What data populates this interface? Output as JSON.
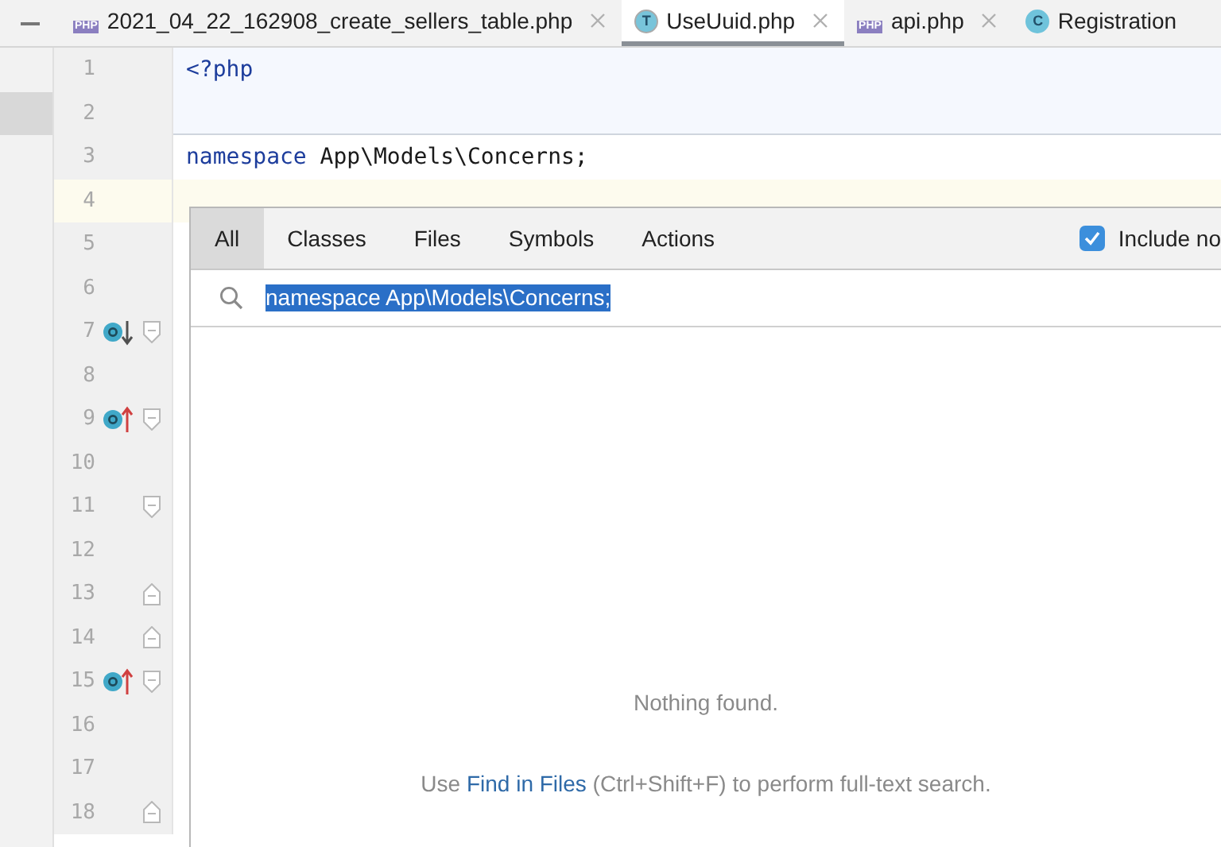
{
  "tabs": [
    {
      "label": "2021_04_22_162908_create_sellers_table.php",
      "kind": "php",
      "badge": "PHP",
      "selected": false,
      "closable": true
    },
    {
      "label": "UseUuid.php",
      "kind": "trait",
      "badge": "T",
      "selected": true,
      "closable": true
    },
    {
      "label": "api.php",
      "kind": "php",
      "badge": "PHP",
      "selected": false,
      "closable": true
    },
    {
      "label": "Registration",
      "kind": "class",
      "badge": "C",
      "selected": false,
      "closable": false
    }
  ],
  "lines": [
    {
      "number": "1",
      "keyword": "<?php",
      "current": false
    },
    {
      "number": "2",
      "current": false
    },
    {
      "number": "3",
      "keyword": "namespace",
      "rest": " App\\Models\\Concerns;",
      "current": false
    },
    {
      "number": "4",
      "current": true
    },
    {
      "number": "5",
      "current": false
    },
    {
      "number": "6",
      "current": false
    },
    {
      "number": "7",
      "current": false,
      "gutter_icons": [
        {
          "kind": "override-down"
        },
        {
          "kind": "fold-start"
        }
      ]
    },
    {
      "number": "8",
      "current": false
    },
    {
      "number": "9",
      "current": false,
      "gutter_icons": [
        {
          "kind": "override-up"
        },
        {
          "kind": "fold-start"
        }
      ]
    },
    {
      "number": "10",
      "current": false
    },
    {
      "number": "11",
      "current": false,
      "gutter_icons": [
        {
          "kind": "fold-start"
        }
      ]
    },
    {
      "number": "12",
      "current": false
    },
    {
      "number": "13",
      "current": false,
      "gutter_icons": [
        {
          "kind": "fold-end"
        }
      ]
    },
    {
      "number": "14",
      "current": false,
      "gutter_icons": [
        {
          "kind": "fold-end"
        }
      ]
    },
    {
      "number": "15",
      "current": false,
      "gutter_icons": [
        {
          "kind": "override-up"
        },
        {
          "kind": "fold-start"
        }
      ]
    },
    {
      "number": "16",
      "current": false
    },
    {
      "number": "17",
      "current": false
    },
    {
      "number": "18",
      "current": false,
      "gutter_icons": [
        {
          "kind": "fold-end"
        }
      ]
    }
  ],
  "search_popup": {
    "tabs": [
      {
        "label": "All",
        "selected": true
      },
      {
        "label": "Classes",
        "selected": false
      },
      {
        "label": "Files",
        "selected": false
      },
      {
        "label": "Symbols",
        "selected": false
      },
      {
        "label": "Actions",
        "selected": false
      }
    ],
    "option": {
      "label": "Include no",
      "checked": true
    },
    "query": "namespace App\\Models\\Concerns;",
    "empty_message": "Nothing found.",
    "hint": {
      "before": "Use ",
      "link": "Find in Files",
      "after": " (Ctrl+Shift+F) to perform full-text search."
    }
  }
}
